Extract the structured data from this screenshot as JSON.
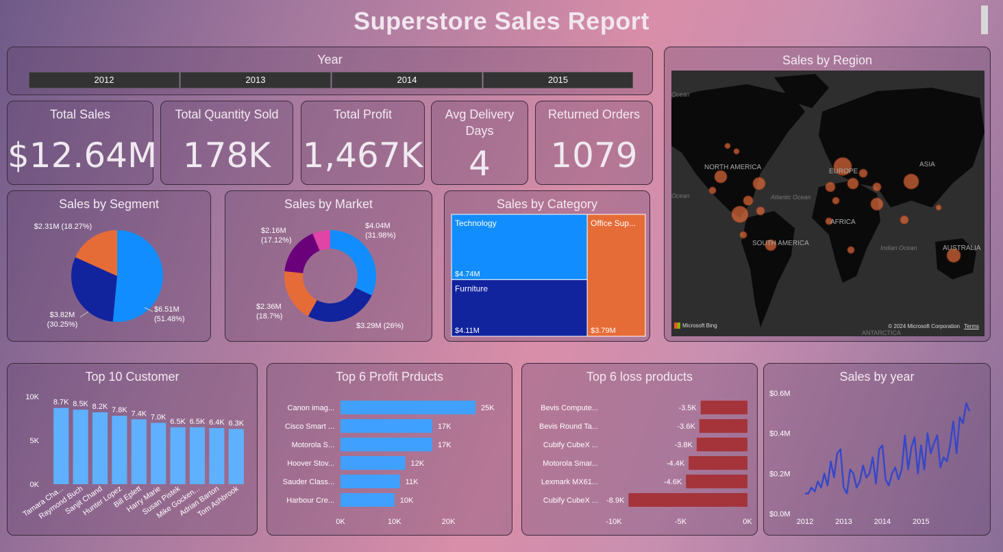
{
  "title": "Superstore Sales Report",
  "year_slicer": {
    "title": "Year",
    "options": [
      "2012",
      "2013",
      "2014",
      "2015"
    ]
  },
  "kpis": [
    {
      "label": "Total Sales",
      "value": "$12.64M"
    },
    {
      "label": "Total Quantity Sold",
      "value": "178K"
    },
    {
      "label": "Total Profit",
      "value": "1,467K"
    },
    {
      "label": "Avg Delivery Days",
      "label_line1": "Avg Delivery",
      "label_line2": "Days",
      "value": "4"
    },
    {
      "label": "Returned Orders",
      "value": "1079"
    }
  ],
  "map": {
    "title": "Sales by Region",
    "labels": [
      "NORTH AMERICA",
      "EUROPE",
      "ASIA",
      "AFRICA",
      "SOUTH AMERICA",
      "AUSTRALIA",
      "Atlantic Ocean",
      "Indian Ocean",
      "Ocean",
      "Ocean",
      "ANTARCTICA"
    ],
    "bing": "Microsoft Bing",
    "copyright": "© 2024 Microsoft Corporation",
    "terms": "Terms"
  },
  "colors": {
    "light_blue": "#118dff",
    "navy": "#12239e",
    "orange": "#e66c37",
    "purple": "#6b007b",
    "magenta": "#e044a7",
    "bar_blue": "#5fb0ff",
    "loss_red": "#a4343a",
    "line_blue": "#3548c8"
  },
  "chart_data": [
    {
      "type": "pie",
      "title": "Sales by Segment",
      "slices": [
        {
          "value": 6.51,
          "percent": 51.48,
          "label": "$6.51M",
          "pct_label": "(51.48%)",
          "color": "#118dff"
        },
        {
          "value": 3.82,
          "percent": 30.25,
          "label": "$3.82M",
          "pct_label": "(30.25%)",
          "color": "#12239e"
        },
        {
          "value": 2.31,
          "percent": 18.27,
          "label": "$2.31M",
          "pct_label": "(18.27%)",
          "color": "#e66c37"
        }
      ]
    },
    {
      "type": "pie",
      "title": "Sales by Market",
      "donut": true,
      "slices": [
        {
          "value": 4.04,
          "percent": 31.98,
          "label": "$4.04M",
          "pct_label": "(31.98%)",
          "color": "#118dff"
        },
        {
          "value": 3.29,
          "percent": 26.0,
          "label": "$3.29M (26%)",
          "pct_label": "",
          "color": "#12239e"
        },
        {
          "value": 2.36,
          "percent": 18.7,
          "label": "$2.36M",
          "pct_label": "(18.7%)",
          "color": "#e66c37"
        },
        {
          "value": 2.16,
          "percent": 17.12,
          "label": "$2.16M",
          "pct_label": "(17.12%)",
          "color": "#6b007b"
        },
        {
          "value": 0.79,
          "percent": 6.2,
          "label": "",
          "pct_label": "",
          "color": "#e044a7"
        }
      ]
    },
    {
      "type": "treemap",
      "title": "Sales by Category",
      "items": [
        {
          "name": "Technology",
          "value": 4.74,
          "label": "$4.74M",
          "color": "#118dff"
        },
        {
          "name": "Furniture",
          "value": 4.11,
          "label": "$4.11M",
          "color": "#12239e"
        },
        {
          "name": "Office Sup...",
          "value": 3.79,
          "label": "$3.79M",
          "color": "#e66c37"
        }
      ]
    },
    {
      "type": "bar",
      "title": "Top 10 Customer",
      "categories": [
        "Tamara Cha...",
        "Raymond Buch",
        "Sanjit Chand",
        "Hunter Lopez",
        "Bill Eplett",
        "Harry Marie",
        "Susan Pistek",
        "Mike Gocken...",
        "Adrian Barton",
        "Tom Ashbrook"
      ],
      "values": [
        8.7,
        8.5,
        8.2,
        7.8,
        7.4,
        7.0,
        6.5,
        6.5,
        6.4,
        6.3
      ],
      "value_labels": [
        "8.7K",
        "8.5K",
        "8.2K",
        "7.8K",
        "7.4K",
        "7.0K",
        "6.5K",
        "6.5K",
        "6.4K",
        "6.3K"
      ],
      "yticks": [
        "0K",
        "5K",
        "10K"
      ],
      "ylim": [
        0,
        10
      ]
    },
    {
      "type": "bar",
      "orientation": "horizontal",
      "title": "Top 6 Profit Prducts",
      "categories": [
        "Canon imag...",
        "Cisco Smart ...",
        "Motorola S...",
        "Hoover Stov...",
        "Sauder Class...",
        "Harbour Cre..."
      ],
      "values": [
        25,
        17,
        17,
        12,
        11,
        10
      ],
      "value_labels": [
        "25K",
        "17K",
        "17K",
        "12K",
        "11K",
        "10K"
      ],
      "xticks": [
        "0K",
        "10K",
        "20K"
      ],
      "xlim": [
        0,
        25
      ]
    },
    {
      "type": "bar",
      "orientation": "horizontal",
      "title": "Top 6 loss products",
      "categories": [
        "Bevis Compute...",
        "Bevis Round Ta...",
        "Cubify CubeX ...",
        "Motorola Smar...",
        "Lexmark MX61...",
        "Cubify CubeX ..."
      ],
      "values": [
        -3.5,
        -3.6,
        -3.8,
        -4.4,
        -4.6,
        -8.9
      ],
      "value_labels": [
        "-3.5K",
        "-3.6K",
        "-3.8K",
        "-4.4K",
        "-4.6K",
        "-8.9K"
      ],
      "xticks": [
        "-10K",
        "-5K",
        "0K"
      ],
      "xlim": [
        -10,
        0
      ]
    },
    {
      "type": "line",
      "title": "Sales by year",
      "xticks": [
        "2012",
        "2013",
        "2014",
        "2015"
      ],
      "yticks": [
        "$0.0M",
        "$0.2M",
        "$0.4M",
        "$0.6M"
      ],
      "ylim": [
        0,
        0.6
      ],
      "values": [
        0.1,
        0.1,
        0.13,
        0.11,
        0.16,
        0.13,
        0.2,
        0.14,
        0.26,
        0.18,
        0.3,
        0.32,
        0.13,
        0.1,
        0.22,
        0.2,
        0.13,
        0.16,
        0.24,
        0.18,
        0.2,
        0.28,
        0.15,
        0.32,
        0.34,
        0.17,
        0.14,
        0.2,
        0.23,
        0.17,
        0.22,
        0.39,
        0.22,
        0.33,
        0.38,
        0.2,
        0.34,
        0.22,
        0.4,
        0.3,
        0.35,
        0.39,
        0.23,
        0.28,
        0.26,
        0.34,
        0.46,
        0.3,
        0.48,
        0.45,
        0.55,
        0.51
      ]
    }
  ]
}
